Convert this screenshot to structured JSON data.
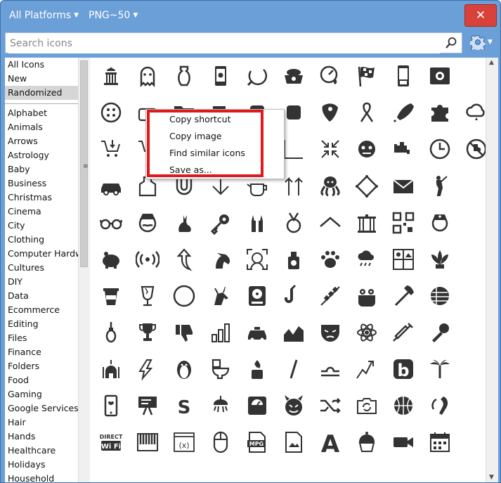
{
  "title_bar": {
    "platform_label": "All Platforms",
    "format_label": "PNG~50",
    "close_label": "✕"
  },
  "search": {
    "placeholder": "Search icons"
  },
  "sidebar": {
    "top_items": [
      "All Icons",
      "New",
      "Randomized"
    ],
    "selected": "Randomized",
    "categories": [
      "Alphabet",
      "Animals",
      "Arrows",
      "Astrology",
      "Baby",
      "Business",
      "Christmas",
      "Cinema",
      "City",
      "Clothing",
      "Computer Hardware",
      "Cultures",
      "DIY",
      "Data",
      "Ecommerce",
      "Editing",
      "Files",
      "Finance",
      "Folders",
      "Food",
      "Gaming",
      "Google Services",
      "Hair",
      "Hands",
      "Healthcare",
      "Holidays",
      "Household"
    ]
  },
  "context_menu": {
    "items": [
      "Copy shortcut",
      "Copy image",
      "Find similar icons",
      "Save as..."
    ]
  },
  "icons": [
    [
      "capitol-icon",
      "ghost-icon",
      "vase-icon",
      "android-phone-icon",
      "sickle-icon",
      "dog-bowl-icon",
      "gauge-drop-icon",
      "checkered-flag-icon",
      "mobile-phone-icon",
      "safe-icon"
    ],
    [
      "button-icon",
      "toaster-icon",
      "folder-icon",
      "cup-icon",
      "card-icon",
      "camera-icon",
      "guitar-pick-icon",
      "ribbon-icon",
      "rocket-icon",
      "puzzle-icon",
      "cloud-icon"
    ],
    [
      "cart-down-icon",
      "cart-return-icon",
      "rotate-icon",
      "bracket-icon",
      "arrow-right-icon",
      "chart-icon",
      "compress-icon",
      "zombie-icon",
      "faucet-icon",
      "clock-icon",
      "no-hand-icon"
    ],
    [
      "car-icon",
      "apron-icon",
      "magnet-icon",
      "arrow-down-icon",
      "teapot-icon",
      "arrows-up-icon",
      "octopus-icon",
      "diamond-icon",
      "envelope-icon",
      "golfer-icon"
    ],
    [
      "glasses-icon",
      "mustache-man-icon",
      "rabbit-icon",
      "key-icon",
      "hands-icon",
      "medal-icon",
      "roof-icon",
      "gate-icon",
      "qr-code-icon",
      "nurse-icon"
    ],
    [
      "piggy-bank-icon",
      "wireless-icon",
      "arrow-curve-icon",
      "horse-icon",
      "face-scan-icon",
      "ink-bottle-icon",
      "paw-icon",
      "rain-cloud-icon",
      "collage-icon",
      "lotus-icon"
    ],
    [
      "coffee-cup-icon",
      "broken-glass-icon",
      "circle-icon",
      "giraffe-icon",
      "hard-drive-icon",
      "saxophone-icon",
      "skewer-icon",
      "frog-pot-icon",
      "axe-icon",
      "bandage-ball-icon"
    ],
    [
      "noose-icon",
      "trophy-cup-icon",
      "thumbs-down-icon",
      "bar-chart-icon",
      "taxi-icon",
      "area-chart-icon",
      "mask-icon",
      "atom-icon",
      "syringe-icon",
      "microphone-icon"
    ],
    [
      "mosque-icon",
      "bolt-arrow-icon",
      "penguin-icon",
      "toilet-icon",
      "fire-bottle-icon",
      "slash-icon",
      "libra-icon",
      "trend-icon",
      "b-logo-icon",
      "palm-tree-icon"
    ],
    [
      "iphone-icon",
      "sign-icon",
      "s-logo-icon",
      "shower-icon",
      "scale-icon",
      "devil-icon",
      "shuffle-icon",
      "camera-rotate-icon",
      "basketball-icon",
      "hearing-aid-icon"
    ],
    [
      "wifi-direct-icon",
      "piano-icon",
      "function-icon",
      "mouse-icon",
      "mpg-file-icon",
      "image-file-icon",
      "letter-a-icon",
      "cupcake-icon",
      "video-camera-icon",
      "calendar-icon"
    ]
  ],
  "wifi_direct_text": [
    "DIRECT",
    "Wi Fi"
  ],
  "mpg_text": "MPG",
  "function_text": "(x)",
  "s_logo_text": "S",
  "a_text": "A",
  "b_logo_text": "b"
}
